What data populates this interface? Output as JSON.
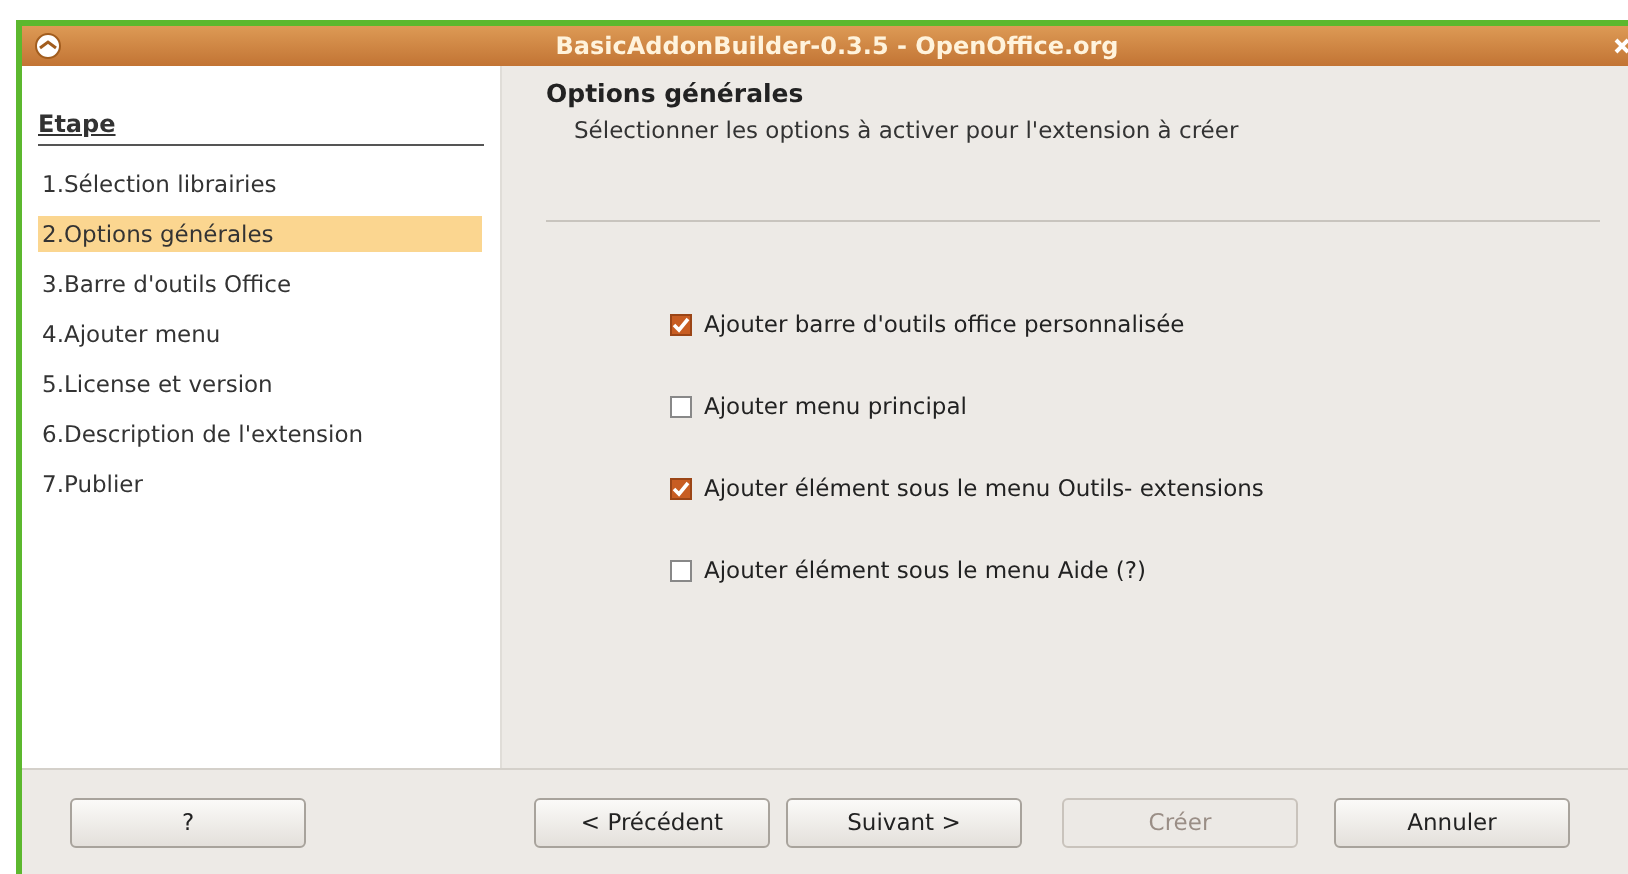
{
  "window": {
    "title": "BasicAddonBuilder-0.3.5 - OpenOffice.org"
  },
  "sidebar": {
    "heading": "Etape",
    "items": [
      {
        "label": "1.Sélection librairies",
        "selected": false
      },
      {
        "label": "2.Options générales",
        "selected": true
      },
      {
        "label": "3.Barre d'outils Office",
        "selected": false
      },
      {
        "label": "4.Ajouter menu",
        "selected": false
      },
      {
        "label": "5.License et version",
        "selected": false
      },
      {
        "label": "6.Description de l'extension",
        "selected": false
      },
      {
        "label": "7.Publier",
        "selected": false
      }
    ]
  },
  "content": {
    "title": "Options générales",
    "subtitle": "Sélectionner les options à activer pour l'extension à créer",
    "options": [
      {
        "label": "Ajouter barre d'outils office personnalisée",
        "checked": true
      },
      {
        "label": "Ajouter menu principal",
        "checked": false
      },
      {
        "label": "Ajouter élément sous le menu Outils- extensions",
        "checked": true
      },
      {
        "label": "Ajouter élément sous le menu Aide (?)",
        "checked": false
      }
    ]
  },
  "buttons": [
    {
      "label": "?",
      "disabled": false
    },
    {
      "label": "< Précédent",
      "disabled": false
    },
    {
      "label": "Suivant >",
      "disabled": false
    },
    {
      "label": "Créer",
      "disabled": true
    },
    {
      "label": "Annuler",
      "disabled": false
    }
  ]
}
